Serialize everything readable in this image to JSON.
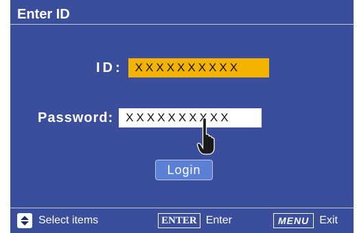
{
  "header": {
    "title": "Enter ID"
  },
  "form": {
    "id_label": "ID:",
    "id_value": "XXXXXXXXXX",
    "password_label": "Password:",
    "password_value": "XXXXXXXXXX",
    "login_label": "Login"
  },
  "footer": {
    "select_label": "Select items",
    "enter_key": "ENTER",
    "enter_label": "Enter",
    "menu_key": "MENU",
    "exit_label": "Exit"
  },
  "colors": {
    "background": "#3a4e9b",
    "id_field": "#f3b300",
    "password_field": "#ffffff",
    "login_button": "#5b80d6"
  },
  "icons": {
    "pointer": "hand-pointer-icon",
    "select": "up-down-arrows-icon"
  }
}
